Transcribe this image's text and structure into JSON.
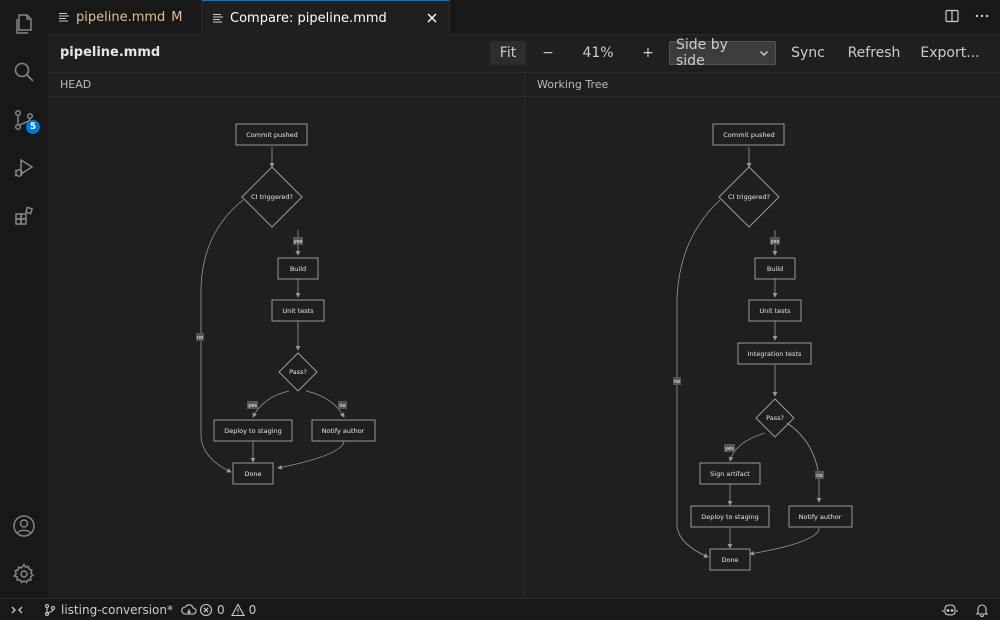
{
  "activity_bar": {
    "items": [
      {
        "name": "explorer-icon"
      },
      {
        "name": "search-icon"
      },
      {
        "name": "source-control-icon",
        "badge": "5"
      },
      {
        "name": "run-debug-icon"
      },
      {
        "name": "extensions-icon"
      }
    ],
    "bottom": [
      {
        "name": "account-icon"
      },
      {
        "name": "settings-gear-icon"
      }
    ]
  },
  "tabs": [
    {
      "label": "pipeline.mmd",
      "modified": "M",
      "active": false
    },
    {
      "label": "Compare: pipeline.mmd",
      "active": true
    }
  ],
  "toolbar": {
    "file_title": "pipeline.mmd",
    "fit_label": "Fit",
    "zoom_out_label": "−",
    "zoom_level": "41%",
    "zoom_in_label": "+",
    "view_mode": "Side by side",
    "sync_label": "Sync",
    "refresh_label": "Refresh",
    "export_label": "Export..."
  },
  "panes": {
    "left": {
      "title": "HEAD",
      "nodes": {
        "commit": "Commit pushed",
        "ci": "CI triggered?",
        "build": "Build",
        "unit": "Unit tests",
        "pass": "Pass?",
        "deploy": "Deploy to staging",
        "notify": "Notify author",
        "done": "Done"
      },
      "edge_labels": {
        "ci_yes": "yes",
        "ci_no": "no",
        "pass_yes": "yes",
        "pass_no": "no"
      }
    },
    "right": {
      "title": "Working Tree",
      "nodes": {
        "commit": "Commit pushed",
        "ci": "CI triggered?",
        "build": "Build",
        "unit": "Unit tests",
        "integration": "Integration tests",
        "pass": "Pass?",
        "sign": "Sign artifact",
        "deploy": "Deploy to staging",
        "notify": "Notify author",
        "done": "Done"
      },
      "edge_labels": {
        "ci_yes": "yes",
        "ci_no": "no",
        "pass_yes": "yes",
        "pass_no": "no"
      }
    }
  },
  "status_bar": {
    "branch": "listing-conversion*",
    "errors": "0",
    "warnings": "0"
  },
  "colors": {
    "accent": "#0078d4",
    "background": "#1f1f1f",
    "modified": "#e2c08d"
  }
}
